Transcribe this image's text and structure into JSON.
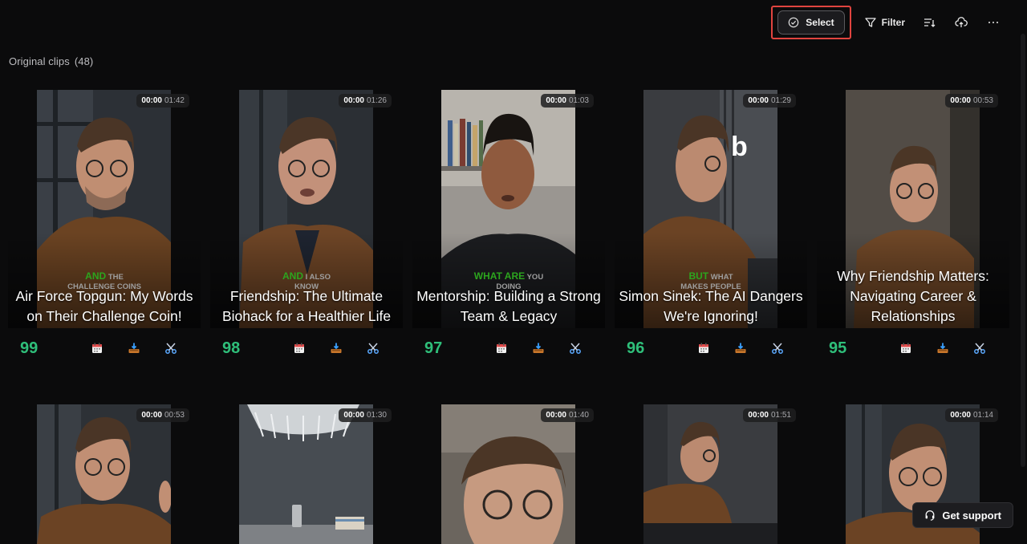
{
  "toolbar": {
    "select_label": "Select",
    "filter_label": "Filter",
    "icons": [
      "check-circle-icon",
      "filter-icon",
      "sort-icon",
      "upload-cloud-icon",
      "more-icon"
    ]
  },
  "section": {
    "title": "Original clips",
    "count": "(48)"
  },
  "clips": [
    {
      "start": "00:00",
      "total": "01:42",
      "caption_hl": "AND",
      "caption_rest": "THE",
      "caption_line2": "CHALLENGE COINS",
      "title": "Air Force Topgun: My Words on Their Challenge Coin!",
      "score": "99"
    },
    {
      "start": "00:00",
      "total": "01:26",
      "caption_hl": "AND",
      "caption_rest": "I ALSO",
      "caption_line2": "KNOW",
      "title": "Friendship: The Ultimate Biohack for a Healthier Life",
      "score": "98"
    },
    {
      "start": "00:00",
      "total": "01:03",
      "caption_hl": "WHAT ARE",
      "caption_rest": "YOU",
      "caption_line2": "DOING",
      "title": "Mentorship: Building a Strong Team & Legacy",
      "score": "97"
    },
    {
      "start": "00:00",
      "total": "01:29",
      "caption_hl": "BUT",
      "caption_rest": "WHAT",
      "caption_line2": "MAKES PEOPLE",
      "title": "Simon Sinek: The AI Dangers We're Ignoring!",
      "score": "96",
      "overlay_letter": "b"
    },
    {
      "start": "00:00",
      "total": "00:53",
      "caption_hl": "",
      "caption_rest": "",
      "caption_line2": "",
      "title": "Why Friendship Matters: Navigating Career & Relationships",
      "score": "95"
    }
  ],
  "clips_row2": [
    {
      "start": "00:00",
      "total": "00:53"
    },
    {
      "start": "00:00",
      "total": "01:30"
    },
    {
      "start": "00:00",
      "total": "01:40"
    },
    {
      "start": "00:00",
      "total": "01:51"
    },
    {
      "start": "00:00",
      "total": "01:14"
    }
  ],
  "card_actions": [
    "calendar-icon",
    "download-icon",
    "edit-scissors-icon"
  ],
  "support": {
    "label": "Get support",
    "icon": "headset-icon"
  },
  "colors": {
    "score": "#2fbf7a",
    "caption_highlight": "#2ca51e",
    "select_highlight": "#e0443f",
    "background": "#0b0b0c"
  }
}
